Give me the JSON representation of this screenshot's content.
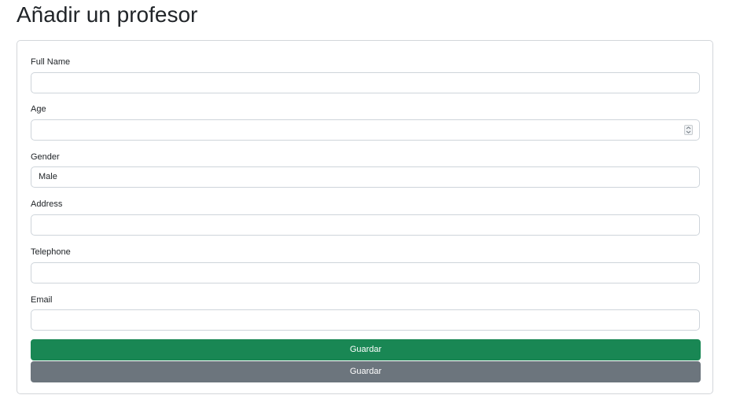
{
  "page": {
    "title": "Añadir un profesor"
  },
  "form": {
    "full_name": {
      "label": "Full Name",
      "value": ""
    },
    "age": {
      "label": "Age",
      "value": ""
    },
    "gender": {
      "label": "Gender",
      "value": "Male"
    },
    "address": {
      "label": "Address",
      "value": ""
    },
    "telephone": {
      "label": "Telephone",
      "value": ""
    },
    "email": {
      "label": "Email",
      "value": ""
    }
  },
  "buttons": {
    "primary_label": "Guardar",
    "secondary_label": "Guardar"
  },
  "colors": {
    "primary_button": "#198754",
    "secondary_button": "#6c757d"
  }
}
